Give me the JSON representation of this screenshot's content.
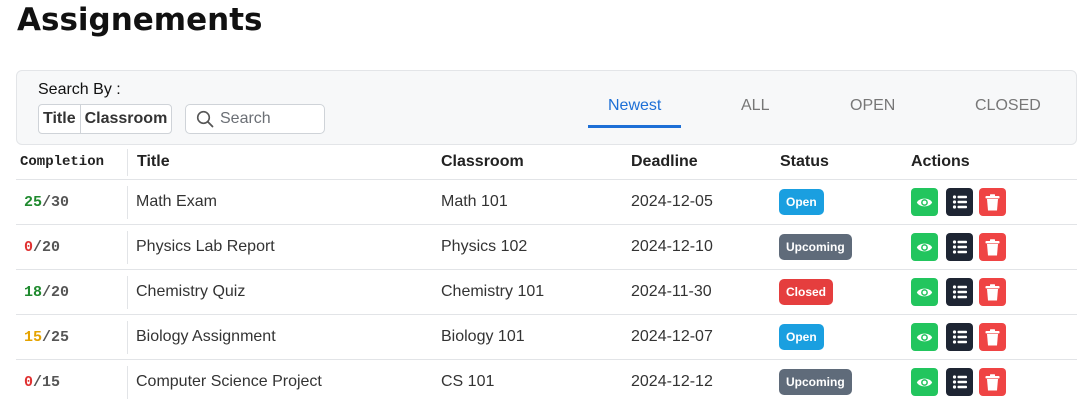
{
  "page": {
    "title": "Assignements"
  },
  "filters": {
    "search_by_label": "Search By :",
    "search_by_options": [
      "Title",
      "Classroom"
    ],
    "search_placeholder": "Search",
    "tabs": [
      {
        "label": "Newest",
        "active": true
      },
      {
        "label": "ALL",
        "active": false
      },
      {
        "label": "OPEN",
        "active": false
      },
      {
        "label": "CLOSED",
        "active": false
      }
    ]
  },
  "table": {
    "headers": {
      "completion": "Completion",
      "title": "Title",
      "classroom": "Classroom",
      "deadline": "Deadline",
      "status": "Status",
      "actions": "Actions"
    },
    "rows": [
      {
        "done": "25",
        "total": "/30",
        "done_color": "green",
        "title": "Math Exam",
        "classroom": "Math 101",
        "deadline": "2024-12-05",
        "status": "Open",
        "status_kind": "open"
      },
      {
        "done": "0",
        "total": "/20",
        "done_color": "red",
        "title": "Physics Lab Report",
        "classroom": "Physics 102",
        "deadline": "2024-12-10",
        "status": "Upcoming",
        "status_kind": "upcoming"
      },
      {
        "done": "18",
        "total": "/20",
        "done_color": "green",
        "title": "Chemistry Quiz",
        "classroom": "Chemistry 101",
        "deadline": "2024-11-30",
        "status": "Closed",
        "status_kind": "closed"
      },
      {
        "done": "15",
        "total": "/25",
        "done_color": "orange",
        "title": "Biology Assignment",
        "classroom": "Biology 101",
        "deadline": "2024-12-07",
        "status": "Open",
        "status_kind": "open"
      },
      {
        "done": "0",
        "total": "/15",
        "done_color": "red",
        "title": "Computer Science Project",
        "classroom": "CS 101",
        "deadline": "2024-12-12",
        "status": "Upcoming",
        "status_kind": "upcoming"
      }
    ],
    "actions": [
      "eye-icon",
      "list-icon",
      "trash-icon"
    ]
  },
  "colors": {
    "accent": "#1d6fd6",
    "open": "#1a9fe0",
    "upcoming": "#5f6b7a",
    "closed": "#e53e3e",
    "view_button": "#22c55e",
    "list_button": "#1e2533",
    "delete_button": "#ef4444"
  }
}
